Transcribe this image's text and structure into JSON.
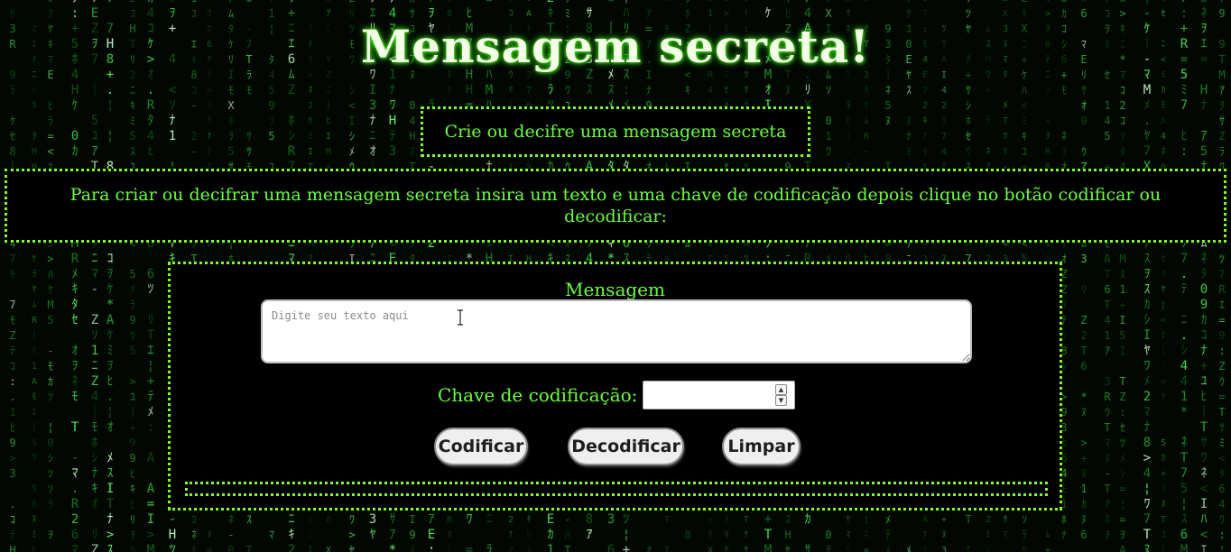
{
  "page": {
    "title": "Mensagem secreta!",
    "subtitle": "Crie ou decifre uma mensagem secreta",
    "instructions": "Para criar ou decifrar uma mensagem secreta insira um texto e uma chave de codificação depois clique no botão codificar ou decodificar:"
  },
  "form": {
    "message_label": "Mensagem",
    "message_placeholder": "Digite seu texto aqui",
    "message_value": "",
    "key_label": "Chave de codificação:",
    "key_value": "",
    "result_text": ""
  },
  "buttons": {
    "encode_label": "Codificar",
    "decode_label": "Decodificar",
    "clear_label": "Limpar"
  },
  "background": {
    "description_icon": "matrix-code-rain",
    "glyphs": "ｦｱｳｴｵｶｷｹｺｻｼｽｾｿﾀﾂﾃﾅﾆﾇﾈﾊﾋﾎﾏﾐﾑﾒﾓﾔﾕﾗﾘﾜ0123456789THEMATRIXZ:.=*+-<>¦｜",
    "colors": [
      "#0b5a12",
      "#12801c",
      "#1ea82a",
      "#2fd13a",
      "#55ff5e",
      "#c8ffc8"
    ]
  },
  "colors": {
    "accent": "#7cff2a",
    "text_green": "#6bff3c",
    "title_glow": "#39e80f",
    "panel_bg": "#000000",
    "button_bg": "#efefef"
  }
}
